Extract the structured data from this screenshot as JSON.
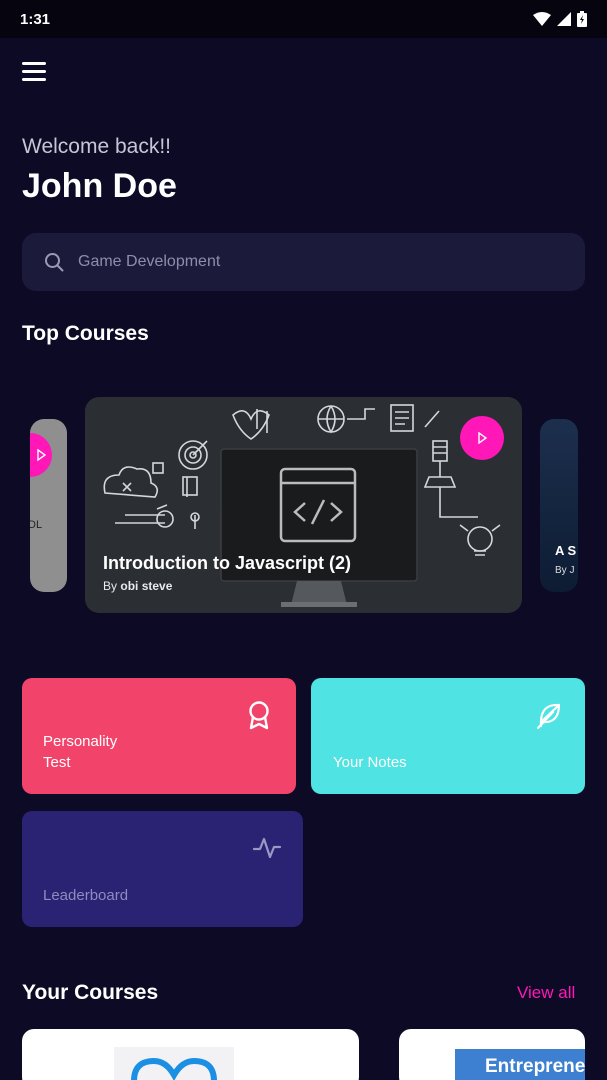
{
  "status_bar": {
    "time": "1:31"
  },
  "greeting": "Welcome back!!",
  "user_name": "John Doe",
  "search": {
    "placeholder": "Game Development"
  },
  "top_courses": {
    "title": "Top Courses",
    "featured": {
      "title": "Introduction to Javascript (2)",
      "by": "By",
      "author": "obi steve"
    },
    "left_peek": {
      "text": "DL"
    },
    "right_peek": {
      "title": "A S",
      "by": "By J"
    }
  },
  "tiles": {
    "personality": {
      "label_line1": "Personality",
      "label_line2": "Test",
      "color": "#f2436a"
    },
    "notes": {
      "label": "Your Notes",
      "color": "#4fe3e3"
    },
    "leaderboard": {
      "label": "Leaderboard",
      "color": "#2a2273"
    }
  },
  "your_courses": {
    "title": "Your Courses",
    "view_all": "View all",
    "cards": [
      {
        "banner_text": ""
      },
      {
        "banner_text": "Entreprene"
      }
    ]
  },
  "colors": {
    "accent": "#ff17b8",
    "background": "#0c0a24"
  }
}
